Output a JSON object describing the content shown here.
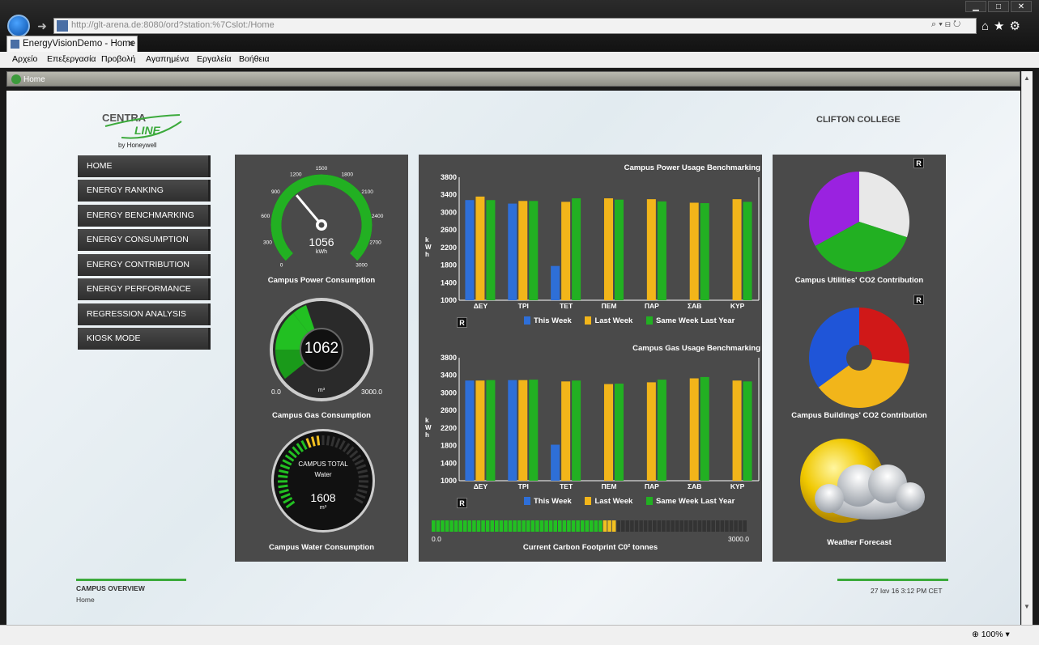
{
  "browser": {
    "url": "http://glt-arena.de:8080/ord?station:%7Cslot:/Home",
    "tab_title": "EnergyVisionDemo - Home",
    "tab_close": "✕",
    "menu": [
      "Αρχείο",
      "Επεξεργασία",
      "Προβολή",
      "Αγαπημένα",
      "Εργαλεία",
      "Βοήθεια"
    ],
    "breadcrumb": "Home",
    "zoom": "100%",
    "addr_tools": "⌕ ▾ ⊟ ↻",
    "nav_icons": "⌂★⚙"
  },
  "page": {
    "brand_line1": "CENTRA",
    "brand_line2": "LINE",
    "brand_by": "by Honeywell",
    "college": "CLIFTON COLLEGE",
    "nav": [
      "HOME",
      "ENERGY RANKING",
      "ENERGY BENCHMARKING",
      "ENERGY CONSUMPTION",
      "ENERGY CONTRIBUTION",
      "ENERGY PERFORMANCE",
      "REGRESSION ANALYSIS",
      "KIOSK MODE"
    ],
    "gauges": {
      "power": {
        "value": "1056",
        "unit": "kWh",
        "label": "Campus Power Consumption",
        "ticks": [
          "0",
          "300",
          "600",
          "900",
          "1200",
          "1500",
          "1800",
          "2100",
          "2400",
          "2700",
          "3000"
        ],
        "max": 3000,
        "reading": 1056
      },
      "gas": {
        "value": "1062",
        "unit": "m³",
        "min": "0.0",
        "max": "3000.0",
        "label": "Campus Gas Consumption"
      },
      "water": {
        "value": "1608",
        "unit": "m³",
        "title1": "CAMPUS TOTAL",
        "title2": "Water",
        "label": "Campus Water Consumption"
      }
    },
    "carbon": {
      "min": "0.0",
      "max": "3000.0",
      "label": "Current Carbon Footprint C0² tonnes",
      "fraction": 0.58
    },
    "pies": {
      "utilities_label": "Campus Utilities' CO2 Contribution",
      "buildings_label": "Campus Buildings' CO2 Contribution",
      "weather_label": "Weather Forecast"
    },
    "r_badge": "R",
    "axis_unit": "kWh",
    "footer": {
      "title": "CAMPUS OVERVIEW",
      "sub": "Home",
      "datetime": "27 Ιαν 16 3:12 PM CET"
    },
    "colors": {
      "green": "#22b022",
      "blue": "#2e6fd8",
      "orange": "#f2b51a",
      "panel": "#4a4a4a"
    }
  },
  "chart_data": [
    {
      "type": "bar",
      "title": "Campus Power Usage Benchmarking",
      "ylabel": "kWh",
      "ylim": [
        1000,
        3800
      ],
      "yticks": [
        1000,
        1400,
        1800,
        2200,
        2600,
        3000,
        3400,
        3800
      ],
      "categories": [
        "ΔΕΥ",
        "ΤΡΙ",
        "ΤΕΤ",
        "ΠΕΜ",
        "ΠΑΡ",
        "ΣΑΒ",
        "ΚΥΡ"
      ],
      "series": [
        {
          "name": "This Week",
          "color": "#2e6fd8",
          "values": [
            3280,
            3200,
            1780,
            null,
            null,
            null,
            null
          ]
        },
        {
          "name": "Last Week",
          "color": "#f2b51a",
          "values": [
            3360,
            3260,
            3240,
            3320,
            3300,
            3220,
            3300
          ]
        },
        {
          "name": "Same Week Last Year",
          "color": "#22b022",
          "values": [
            3280,
            3260,
            3320,
            3290,
            3250,
            3210,
            3240
          ]
        }
      ]
    },
    {
      "type": "bar",
      "title": "Campus Gas Usage Benchmarking",
      "ylabel": "kWh",
      "ylim": [
        1000,
        3800
      ],
      "yticks": [
        1000,
        1400,
        1800,
        2200,
        2600,
        3000,
        3400,
        3800
      ],
      "categories": [
        "ΔΕΥ",
        "ΤΡΙ",
        "ΤΕΤ",
        "ΠΕΜ",
        "ΠΑΡ",
        "ΣΑΒ",
        "ΚΥΡ"
      ],
      "series": [
        {
          "name": "This Week",
          "color": "#2e6fd8",
          "values": [
            3280,
            3290,
            1820,
            null,
            null,
            null,
            null
          ]
        },
        {
          "name": "Last Week",
          "color": "#f2b51a",
          "values": [
            3280,
            3290,
            3260,
            3200,
            3240,
            3330,
            3280
          ]
        },
        {
          "name": "Same Week Last Year",
          "color": "#22b022",
          "values": [
            3290,
            3300,
            3280,
            3210,
            3300,
            3360,
            3260
          ]
        }
      ]
    },
    {
      "type": "pie",
      "title": "Campus Utilities' CO2 Contribution",
      "slices": [
        {
          "color": "#e8e8e8",
          "value": 30
        },
        {
          "color": "#22b022",
          "value": 37
        },
        {
          "color": "#9a22e0",
          "value": 33
        }
      ]
    },
    {
      "type": "pie",
      "title": "Campus Buildings' CO2 Contribution",
      "slices": [
        {
          "color": "#d01818",
          "value": 27
        },
        {
          "color": "#f2b51a",
          "value": 38
        },
        {
          "color": "#1f55d8",
          "value": 35
        }
      ]
    }
  ]
}
